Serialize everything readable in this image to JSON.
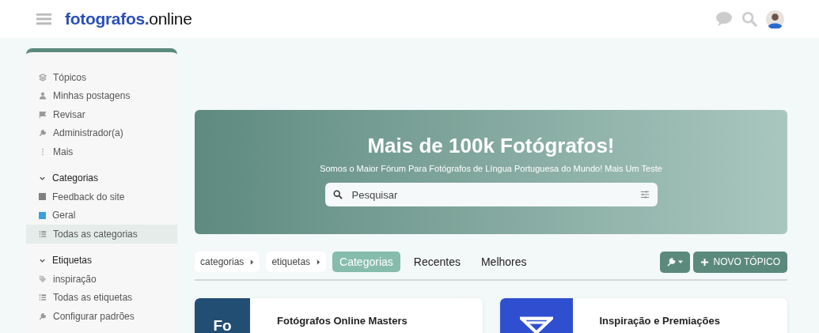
{
  "header": {
    "logo": {
      "primary": "fotografos.",
      "secondary": "online"
    }
  },
  "sidebar": {
    "items": [
      {
        "label": "Tópicos",
        "kind": "layers",
        "selected": false
      },
      {
        "label": "Minhas postagens",
        "kind": "user",
        "selected": false
      },
      {
        "label": "Revisar",
        "kind": "flag",
        "selected": false
      },
      {
        "label": "Administrador(a)",
        "kind": "wrench",
        "selected": false
      },
      {
        "label": "Mais",
        "kind": "dots",
        "selected": false
      }
    ],
    "sections": [
      {
        "title": "Categorias",
        "expanded": true,
        "items": [
          {
            "label": "Feedback do site",
            "kind": "square",
            "color": "#808080",
            "selected": false
          },
          {
            "label": "Geral",
            "kind": "square",
            "color": "#3aa0e0",
            "selected": false
          },
          {
            "label": "Todas as categorias",
            "kind": "list",
            "selected": true
          }
        ]
      },
      {
        "title": "Etiquetas",
        "expanded": true,
        "items": [
          {
            "label": "inspiração",
            "kind": "tag",
            "selected": false
          },
          {
            "label": "Todas as etiquetas",
            "kind": "list",
            "selected": false
          },
          {
            "label": "Configurar padrões",
            "kind": "wrench",
            "selected": false
          }
        ]
      }
    ]
  },
  "banner": {
    "title": "Mais de 100k Fotógrafos!",
    "subtitle": "Somos o Maior Fórum Para Fotógrafos de Língua Portuguesa do Mundo! Mais Um Teste",
    "search": {
      "placeholder": "Pesquisar"
    }
  },
  "nav": {
    "filters": [
      "categorias",
      "etiquetas"
    ],
    "tabs": [
      {
        "label": "Categorias",
        "selected": true
      },
      {
        "label": "Recentes",
        "selected": false
      },
      {
        "label": "Melhores",
        "selected": false
      }
    ],
    "new_topic": "NOVO TÓPICO"
  },
  "categories": [
    {
      "name": "Fotógrafos Online Masters",
      "kind": "text",
      "logo_text": "Fo",
      "color": "#234e74"
    },
    {
      "name": "Inspiração e Premiações",
      "kind": "emblem",
      "color": "#2f4fd0"
    }
  ]
}
